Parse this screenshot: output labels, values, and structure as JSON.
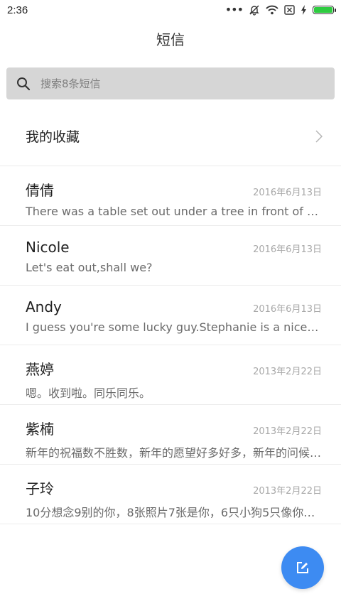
{
  "status_bar": {
    "time": "2:36",
    "icons": [
      "more-dots-icon",
      "bell-off-icon",
      "wifi-icon",
      "no-sim-icon",
      "charging-bolt-icon",
      "battery-icon"
    ],
    "battery_color": "#2ecc40"
  },
  "header": {
    "title": "短信"
  },
  "search": {
    "placeholder": "搜索8条短信",
    "icon": "search-icon"
  },
  "favorites": {
    "label": "我的收藏",
    "icon": "chevron-right-icon"
  },
  "conversations": [
    {
      "name": "倩倩",
      "date": "2016年6月13日",
      "snippet": "There was a table set out under a tree in front of the house"
    },
    {
      "name": "Nicole",
      "date": "2016年6月13日",
      "snippet": "Let's eat out,shall we?"
    },
    {
      "name": "Andy",
      "date": "2016年6月13日",
      "snippet": "I guess you're some lucky guy.Stephanie is a nice girl."
    },
    {
      "name": "燕婷",
      "date": "2013年2月22日",
      "snippet": "嗯。收到啦。同乐同乐。"
    },
    {
      "name": "紫楠",
      "date": "2013年2月22日",
      "snippet": "新年的祝福数不胜数，新年的愿望好多好多，新年的问候送给你"
    },
    {
      "name": "子玲",
      "date": "2013年2月22日",
      "snippet": "10分想念9别的你，8张照片7张是你，6只小狗5只像你，4季"
    }
  ],
  "compose_button": {
    "icon": "compose-icon",
    "color": "#3d8bf2"
  }
}
